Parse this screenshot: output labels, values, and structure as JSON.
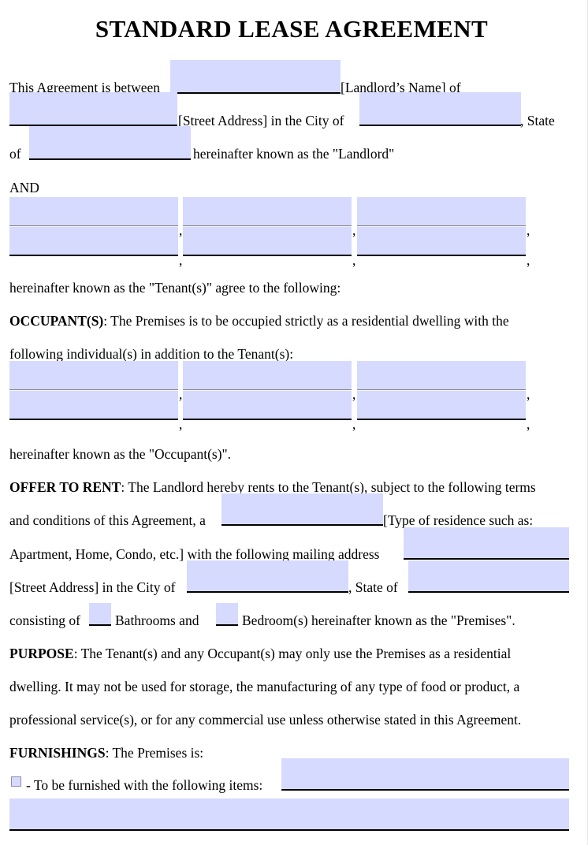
{
  "document": {
    "title": "STANDARD LEASE AGREEMENT"
  },
  "intro": {
    "line1_before": "This Agreement is between",
    "line1_after": "[Landlord’s Name] of",
    "line2_mid": "[Street Address] in the City of",
    "line2_after": ", State",
    "line3_before": "of",
    "line3_after": "hereinafter known as the \"Landlord\""
  },
  "and_section": {
    "label": "AND",
    "separator": ",",
    "rows": [
      {
        "fields": [
          "",
          "",
          ""
        ]
      },
      {
        "fields": [
          "",
          "",
          ""
        ]
      }
    ],
    "closing": "hereinafter known as the \"Tenant(s)\" agree to the following:"
  },
  "occupants": {
    "heading": "OCCUPANT(S)",
    "line1_rest": ": The Premises is to be occupied strictly as a residential dwelling with the",
    "line2": "following individual(s) in addition to the Tenant(s):",
    "separator": ",",
    "rows": [
      {
        "fields": [
          "",
          "",
          ""
        ]
      },
      {
        "fields": [
          "",
          "",
          ""
        ]
      }
    ],
    "closing": "hereinafter known as the \"Occupant(s)\"."
  },
  "offer_to_rent": {
    "heading": "OFFER TO RENT",
    "line1_rest": ": The Landlord hereby rents to the Tenant(s), subject to the following terms",
    "line2_before": "and conditions of this Agreement, a",
    "line2_after": "[Type of residence such as:",
    "line3_before": "Apartment, Home, Condo, etc.] with the following mailing address",
    "line4_before": "[Street Address] in the City of",
    "line4_mid": ", State of",
    "line5_before": "consisting of",
    "line5_mid": "Bathrooms and",
    "line5_after": "Bedroom(s) hereinafter known as the \"Premises\"."
  },
  "purpose": {
    "heading": "PURPOSE",
    "line1_rest": ": The Tenant(s) and any Occupant(s) may only use the Premises as a residential",
    "line2": "dwelling. It may not be used for storage, the manufacturing of any type of food or product, a",
    "line3": "professional service(s), or for any commercial use unless otherwise stated in this Agreement."
  },
  "furnishings": {
    "heading": "FURNISHINGS",
    "heading_rest": ": The Premises is:",
    "option_label": "- To be furnished with the following items:",
    "checkbox_checked": false
  },
  "colors": {
    "field_fill": "#d6daff",
    "checkbox_border": "#8e8ea8",
    "text": "#000000",
    "rule_black": "#000000",
    "rule_gray": "#767676"
  }
}
